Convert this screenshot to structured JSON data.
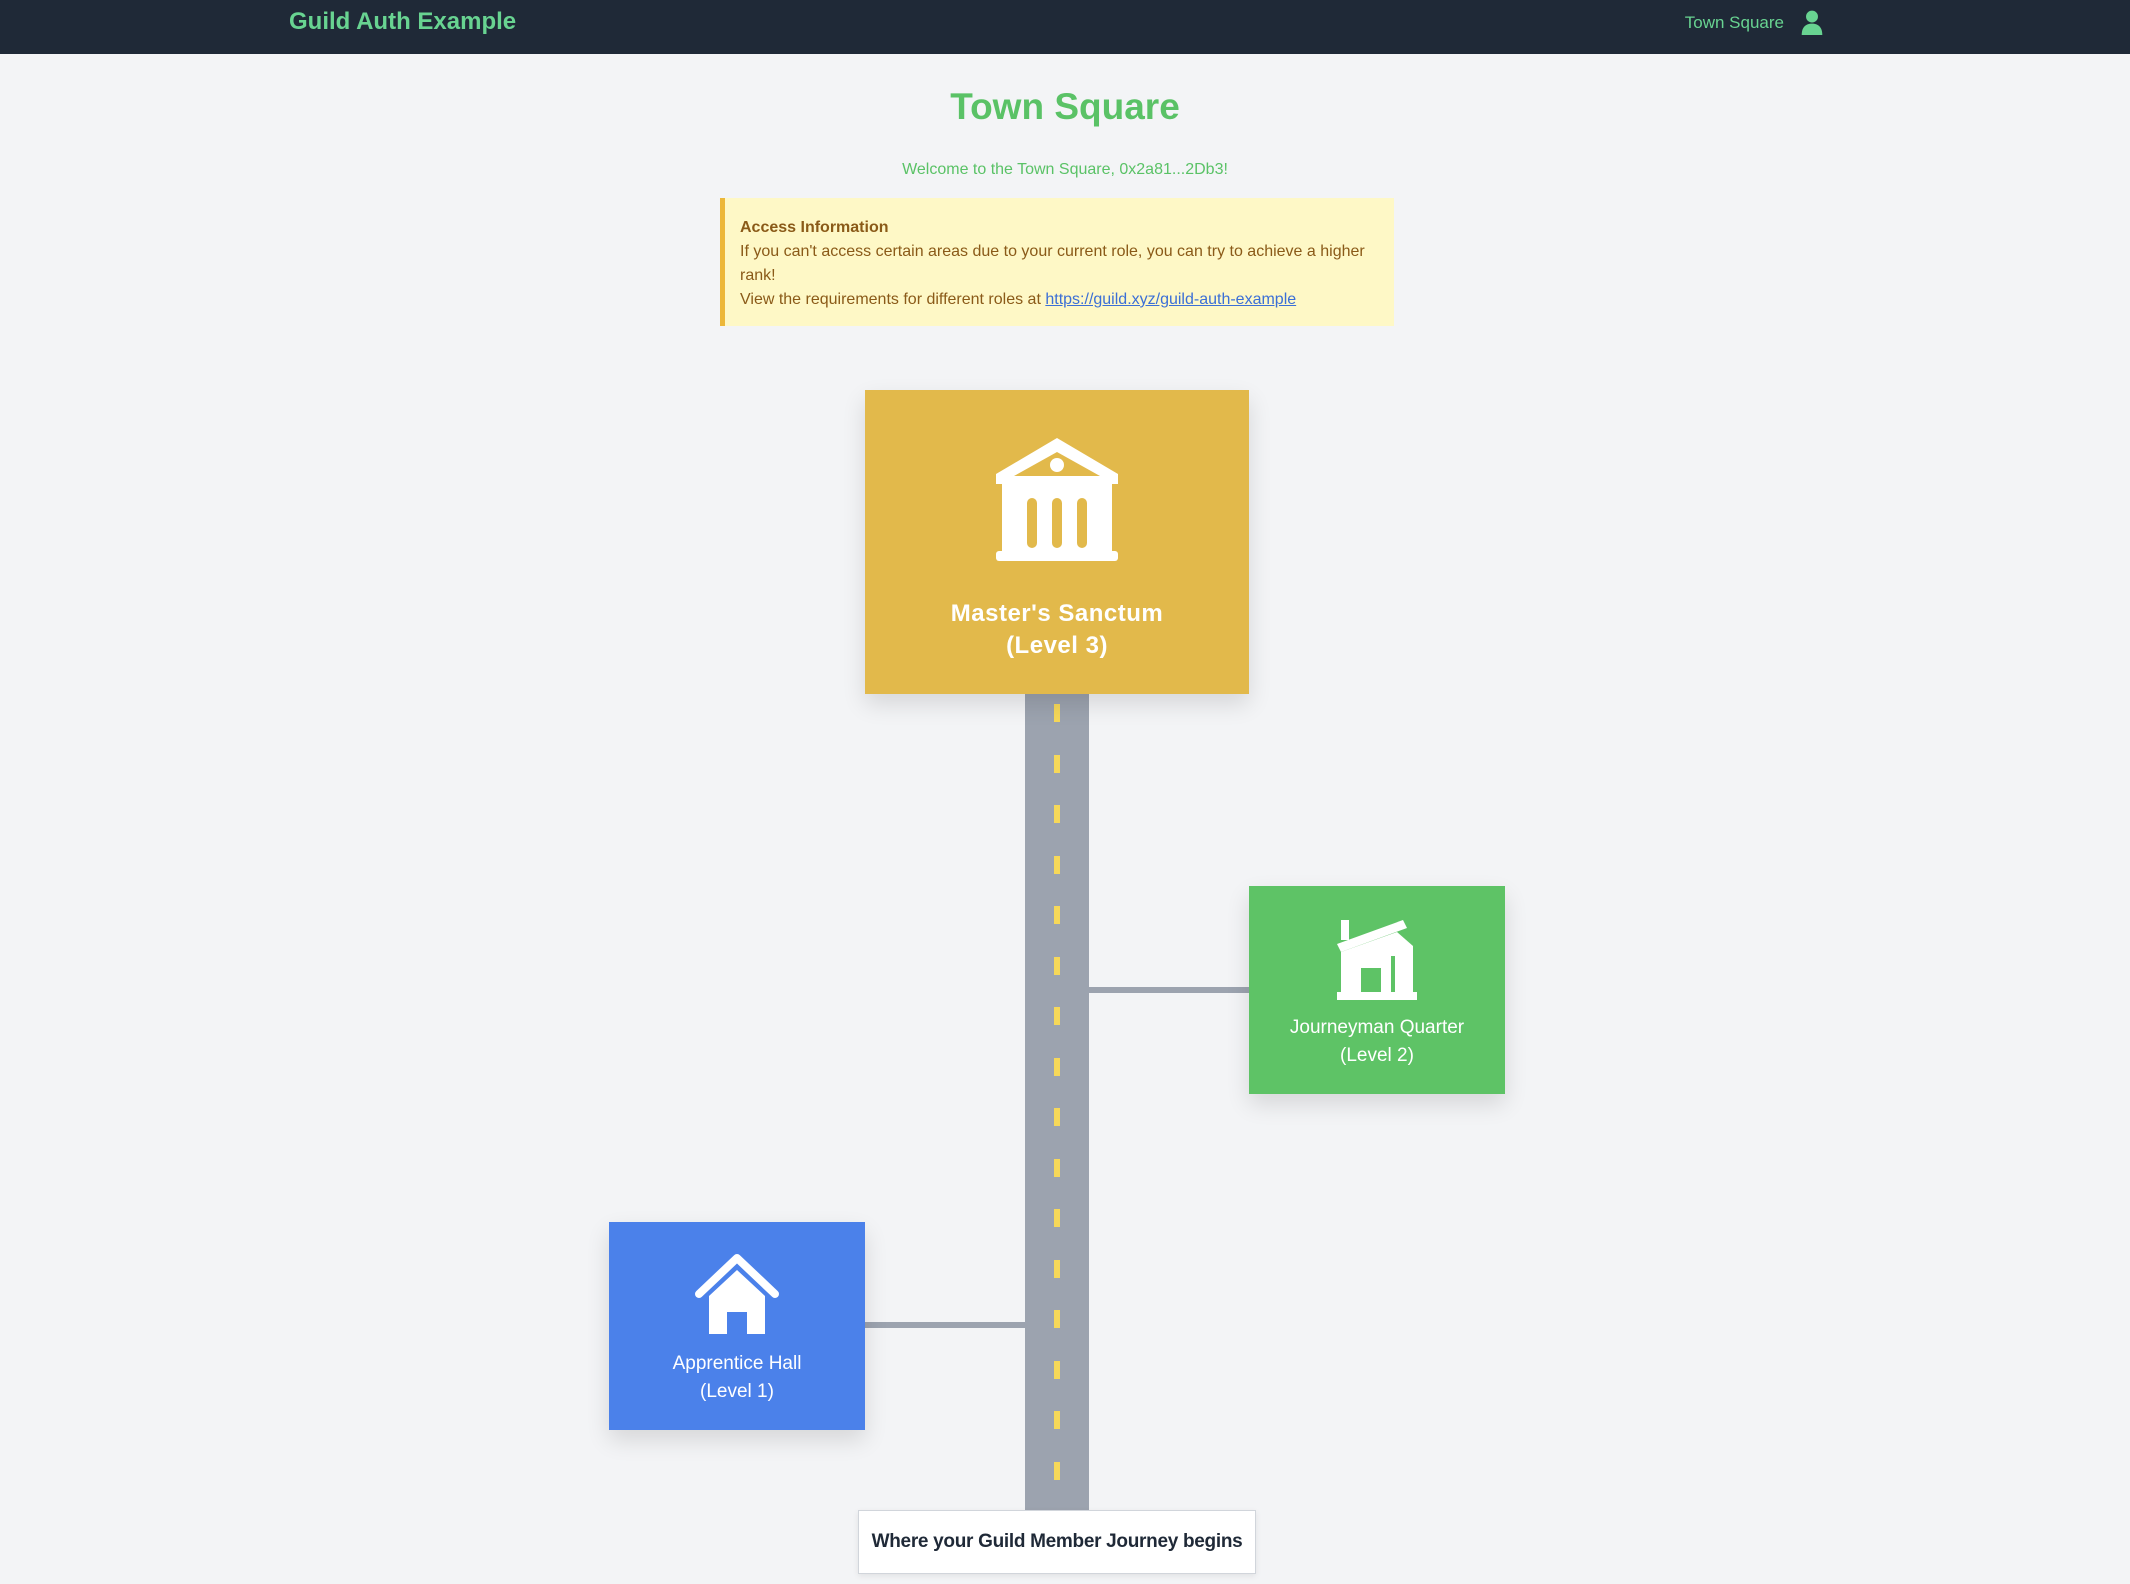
{
  "navbar": {
    "brand": "Guild Auth Example",
    "link": "Town Square",
    "user_icon": "user-icon"
  },
  "page": {
    "title": "Town Square",
    "welcome": "Welcome to the Town Square, 0x2a81...2Db3!"
  },
  "alert": {
    "title": "Access Information",
    "line1": "If you can't access certain areas due to your current role, you can try to achieve a higher rank!",
    "line2_prefix": "View the requirements for different roles at",
    "link": "https://guild.xyz/guild-auth-example"
  },
  "buildings": {
    "master": {
      "name": "Master's Sanctum",
      "level": "(Level 3)",
      "icon": "bank-icon",
      "color": "#e2b94b"
    },
    "journeyman": {
      "name": "Journeyman Quarter",
      "level": "(Level 2)",
      "icon": "house-chimney-icon",
      "color": "#5ec366"
    },
    "apprentice": {
      "name": "Apprentice Hall",
      "level": "(Level 1)",
      "icon": "home-icon",
      "color": "#4b81ea"
    }
  },
  "journey_label": "Where your Guild Member Journey begins",
  "colors": {
    "navbar_bg": "#1f2937",
    "accent_green": "#68d391",
    "road": "#9ca3af",
    "road_dash": "#f6d859",
    "alert_bg": "#fef8c6",
    "alert_border": "#ecb739"
  }
}
